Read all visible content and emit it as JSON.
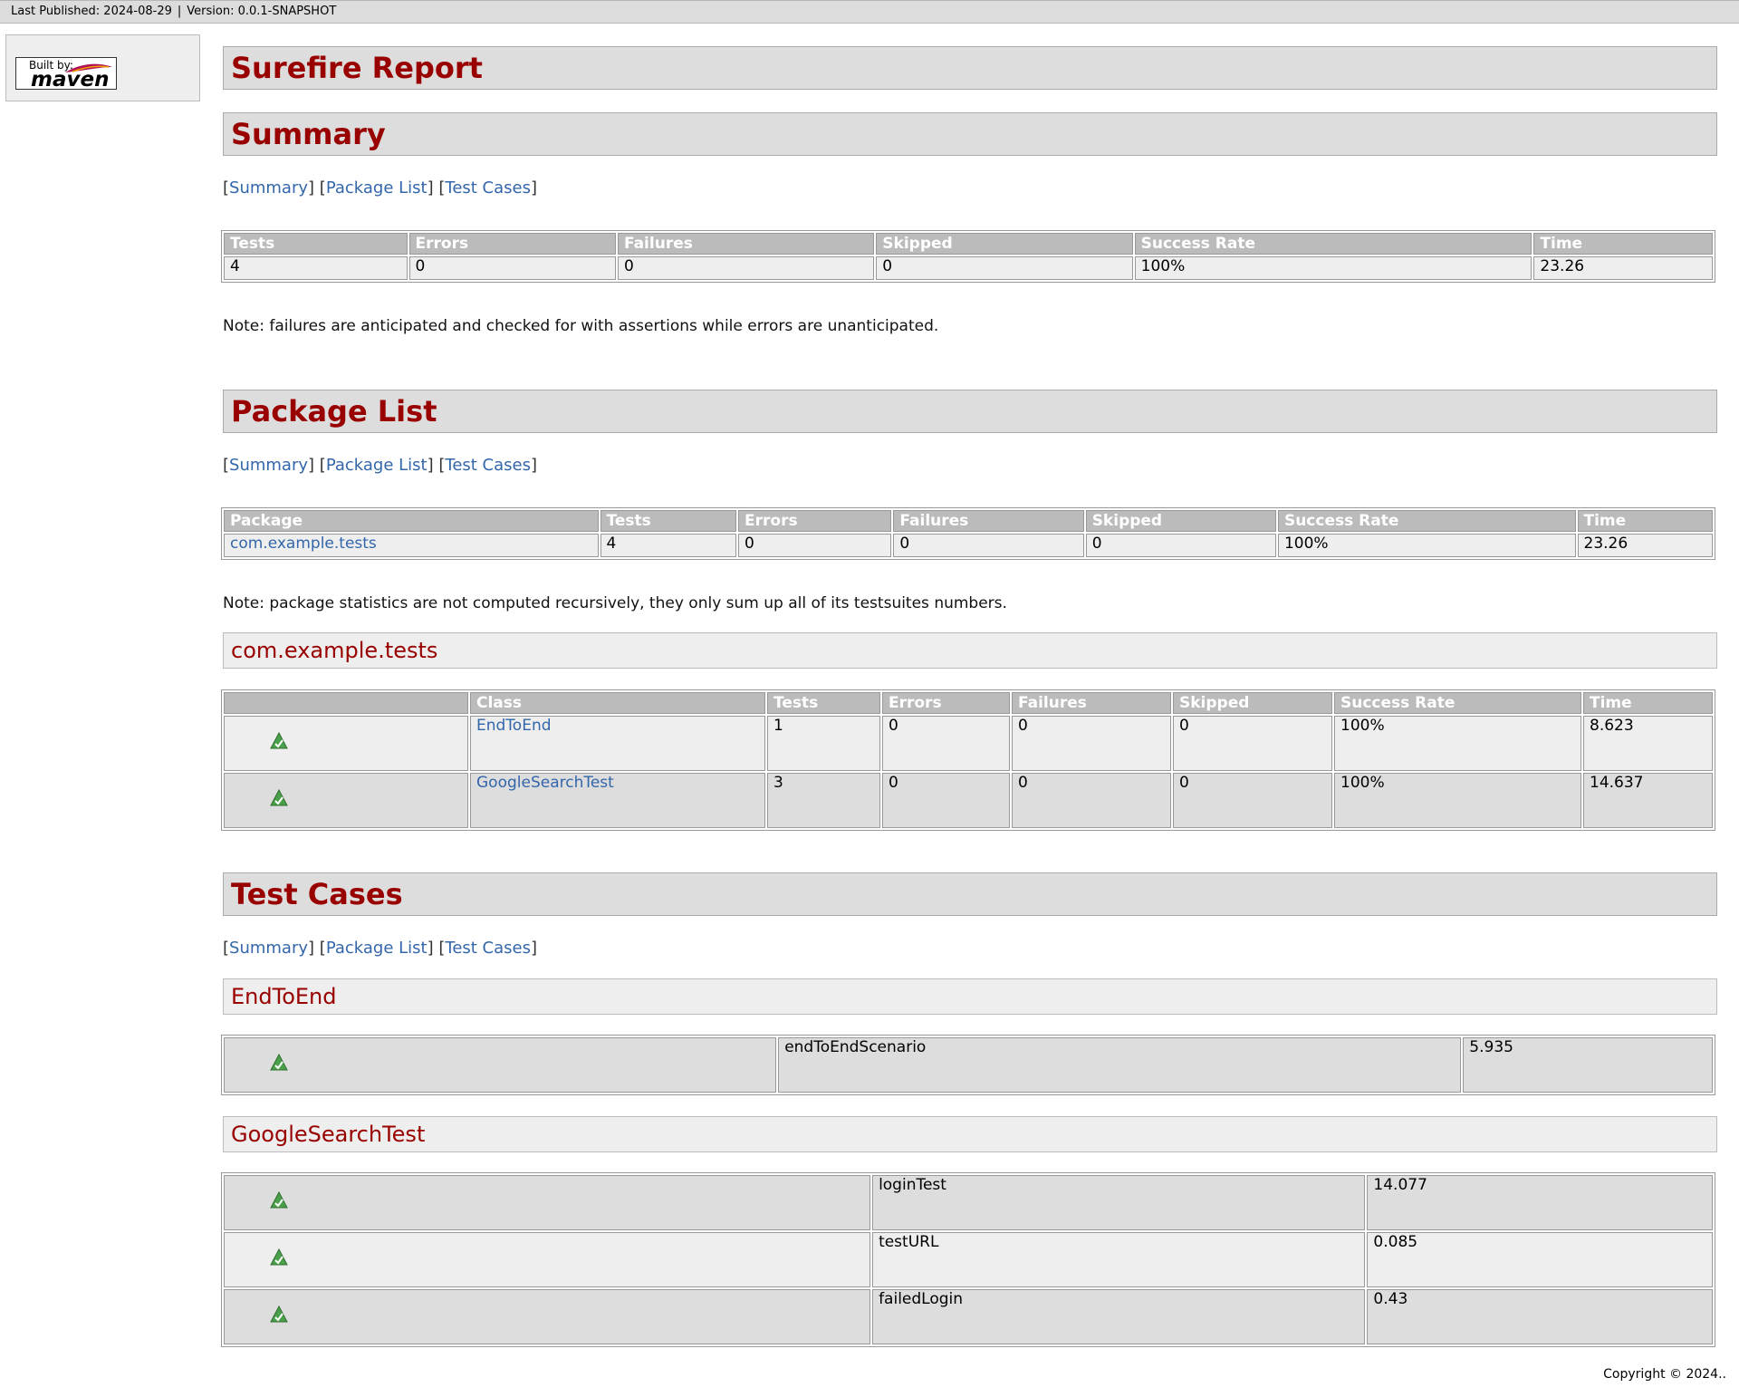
{
  "topbar": {
    "published": "Last Published: 2024-08-29",
    "version": "Version: 0.0.1-SNAPSHOT"
  },
  "logo": {
    "built_by": "Built by:",
    "brand": "maven"
  },
  "title": "Surefire Report",
  "nav": {
    "summary": "Summary",
    "package_list": "Package List",
    "test_cases": "Test Cases"
  },
  "summary": {
    "heading": "Summary",
    "headers": [
      "Tests",
      "Errors",
      "Failures",
      "Skipped",
      "Success Rate",
      "Time"
    ],
    "row": [
      "4",
      "0",
      "0",
      "0",
      "100%",
      "23.26"
    ],
    "note": "Note: failures are anticipated and checked for with assertions while errors are unanticipated."
  },
  "package_list": {
    "heading": "Package List",
    "headers": [
      "Package",
      "Tests",
      "Errors",
      "Failures",
      "Skipped",
      "Success Rate",
      "Time"
    ],
    "row": [
      "com.example.tests",
      "4",
      "0",
      "0",
      "0",
      "100%",
      "23.26"
    ],
    "note": "Note: package statistics are not computed recursively, they only sum up all of its testsuites numbers.",
    "package_heading": "com.example.tests",
    "class_headers": [
      "",
      "Class",
      "Tests",
      "Errors",
      "Failures",
      "Skipped",
      "Success Rate",
      "Time"
    ],
    "classes": [
      [
        "EndToEnd",
        "1",
        "0",
        "0",
        "0",
        "100%",
        "8.623"
      ],
      [
        "GoogleSearchTest",
        "3",
        "0",
        "0",
        "0",
        "100%",
        "14.637"
      ]
    ]
  },
  "test_cases": {
    "heading": "Test Cases",
    "suites": [
      {
        "name": "EndToEnd",
        "cases": [
          [
            "endToEndScenario",
            "5.935"
          ]
        ]
      },
      {
        "name": "GoogleSearchTest",
        "cases": [
          [
            "loginTest",
            "14.077"
          ],
          [
            "testURL",
            "0.085"
          ],
          [
            "failedLogin",
            "0.43"
          ]
        ]
      }
    ]
  },
  "copyright": "Copyright © 2024..",
  "colors": {
    "heading": "#990000",
    "link": "#3366aa",
    "header_bg": "#bbbbbb"
  },
  "icons": {
    "status": "success-icon"
  }
}
